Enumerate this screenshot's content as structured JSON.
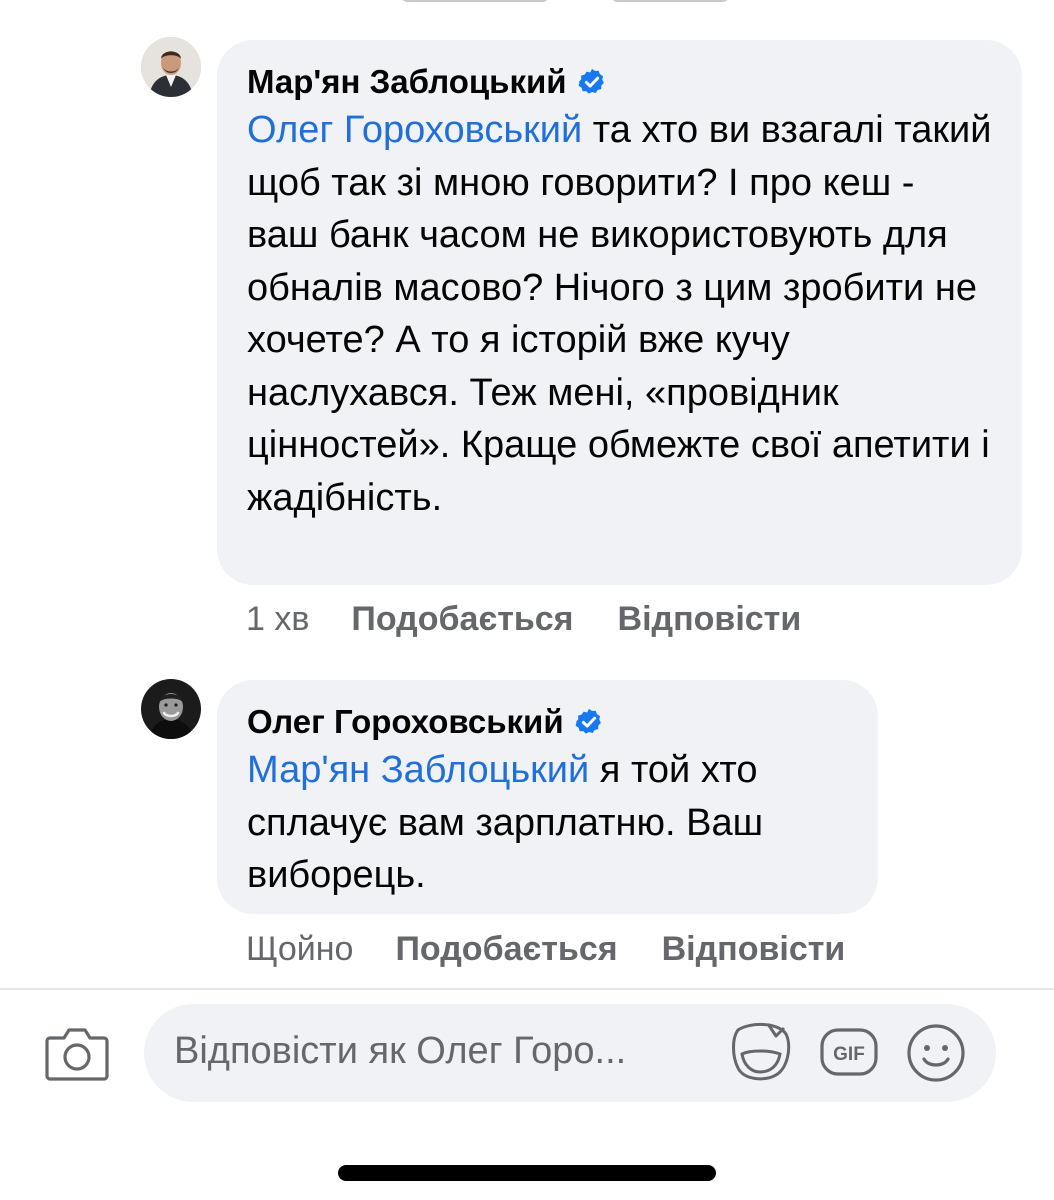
{
  "comments": [
    {
      "author": "Мар'ян Заблоцький",
      "mention": "Олег Гороховський",
      "text": " та хто ви взагалі такий щоб так зі мною говорити? І про кеш - ваш банк часом не використовують для обналів масово? Нічого з цим зробити не хочете? А то я історій вже кучу наслухався. Теж мені, «провідник цінностей». Краще обмежте свої апетити і жадібність.",
      "time": "1 хв",
      "like_label": "Подобається",
      "reply_label": "Відповісти"
    },
    {
      "author": "Олег Гороховський",
      "mention": "Мар'ян Заблоцький",
      "text": " я той хто сплачує вам зарплатню. Ваш виборець.",
      "time": "Щойно",
      "like_label": "Подобається",
      "reply_label": "Відповісти"
    }
  ],
  "composer": {
    "placeholder": "Відповісти як Олег Горо...",
    "icons": [
      "camera-icon",
      "sticker-icon",
      "gif-icon",
      "emoji-icon"
    ],
    "gif_label": "GIF"
  },
  "colors": {
    "mention": "#216fdb",
    "verified": "#1877f2",
    "bubble": "#f0f2f5",
    "meta": "#65676b"
  }
}
